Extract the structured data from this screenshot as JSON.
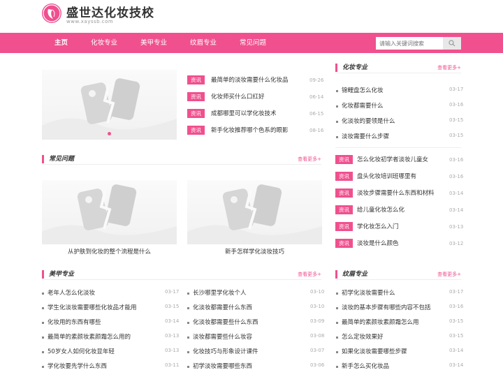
{
  "site": {
    "title": "盛世达化妆技校",
    "url": "www.xayssb.com"
  },
  "nav": {
    "items": [
      "主页",
      "化妆专业",
      "美甲专业",
      "纹眉专业",
      "常见问题"
    ],
    "search_placeholder": "请输入关键词搜索"
  },
  "featured_news": [
    {
      "tag": "资讯",
      "title": "最简单的淡妆需要什么化妆品",
      "date": "09-26"
    },
    {
      "tag": "资讯",
      "title": "化妆师买什么口红好",
      "date": "06-14"
    },
    {
      "tag": "资讯",
      "title": "成都哪里可以学化妆技术",
      "date": "06-15"
    },
    {
      "tag": "资讯",
      "title": "新手化妆推荐哪个色系的眼影",
      "date": "08-16"
    }
  ],
  "faq": {
    "title": "常见问题",
    "more": "查看更多+",
    "cards": [
      {
        "caption": "从护肤到化妆的整个流程是什么"
      },
      {
        "caption": "新手怎样学化淡妆技巧"
      }
    ]
  },
  "makeup": {
    "title": "化妆专业",
    "more": "查看更多+",
    "items": [
      {
        "title": "锦鲤盘怎么化妆",
        "date": "03-17"
      },
      {
        "title": "化妆都需要什么",
        "date": "03-16"
      },
      {
        "title": "化淡妆的要领是什么",
        "date": "03-15"
      },
      {
        "title": "淡妆需要什么步骤",
        "date": "03-15"
      }
    ],
    "news": [
      {
        "tag": "资讯",
        "title": "怎么化妆初学者淡妆儿童女",
        "date": "03-16"
      },
      {
        "tag": "资讯",
        "title": "盘头化妆培训班哪里有",
        "date": "03-16"
      },
      {
        "tag": "资讯",
        "title": "淡妆步骤需要什么东西和材料",
        "date": "03-14"
      },
      {
        "tag": "资讯",
        "title": "给儿童化妆怎么化",
        "date": "03-14"
      },
      {
        "tag": "资讯",
        "title": "学化妆怎么入门",
        "date": "03-13"
      },
      {
        "tag": "资讯",
        "title": "淡妆是什么颜色",
        "date": "03-12"
      }
    ]
  },
  "nail": {
    "title": "美甲专业",
    "more": "查看更多+",
    "left": [
      {
        "title": "老年人怎么化淡妆",
        "date": "03-17"
      },
      {
        "title": "学生化淡妆需要哪些化妆品才能用",
        "date": "03-15"
      },
      {
        "title": "化妆用的东西有哪些",
        "date": "03-14"
      },
      {
        "title": "最简单的素颜妆素颜霜怎么用的",
        "date": "03-13"
      },
      {
        "title": "50岁女人如何化妆显年轻",
        "date": "03-13"
      },
      {
        "title": "学化妆要先学什么东西",
        "date": "03-11"
      }
    ],
    "right": [
      {
        "title": "长沙哪里学化妆个人",
        "date": "03-10"
      },
      {
        "title": "化淡妆都需要什么东西",
        "date": "03-10"
      },
      {
        "title": "化淡妆都需要些什么东西",
        "date": "03-09"
      },
      {
        "title": "淡妆都需要些什么妆容",
        "date": "03-08"
      },
      {
        "title": "化妆技巧与形象设计课件",
        "date": "03-07"
      },
      {
        "title": "初学淡妆需要哪些东西",
        "date": "03-06"
      }
    ]
  },
  "brow": {
    "title": "纹眉专业",
    "more": "查看更多+",
    "items": [
      {
        "title": "初学化淡妆需要什么",
        "date": "03-17"
      },
      {
        "title": "淡妆的基本步骤有哪些内容不包括",
        "date": "03-16"
      },
      {
        "title": "最简单的素颜妆素颜霜怎么用",
        "date": "03-15"
      },
      {
        "title": "怎么定妆效果好",
        "date": "03-15"
      },
      {
        "title": "如果化淡妆需要哪些步骤",
        "date": "03-14"
      },
      {
        "title": "新手怎么买化妆品",
        "date": "03-14"
      }
    ]
  },
  "colors": {
    "brand": "#f0508e",
    "text": "#333333",
    "muted": "#aaaaaa"
  },
  "slider": {
    "current": 1,
    "total": 2
  }
}
